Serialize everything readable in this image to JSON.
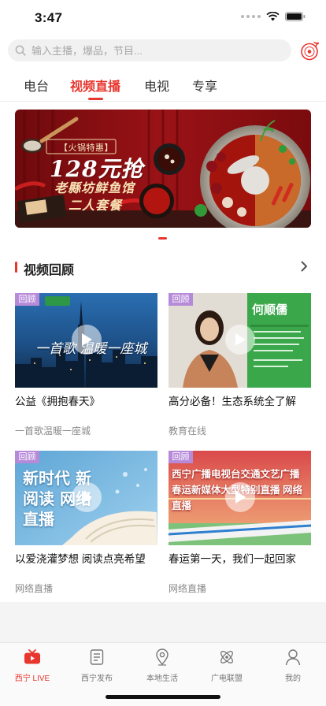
{
  "status_bar": {
    "time": "3:47"
  },
  "search": {
    "placeholder": "输入主播，爆品，节目..."
  },
  "tabs": [
    {
      "label": "电台",
      "active": false
    },
    {
      "label": "视频直播",
      "active": true
    },
    {
      "label": "电视",
      "active": false
    },
    {
      "label": "专享",
      "active": false
    }
  ],
  "banner": {
    "tag": "【火锅特惠】",
    "price": "128元抢",
    "name": "老縣坊鲜鱼馆",
    "set": "二人套餐"
  },
  "section": {
    "title": "视频回顾"
  },
  "cards": [
    {
      "badge": "回顾",
      "title": "公益《拥抱春天》",
      "subtitle": "一首歌温暖一座城",
      "overlay": "一首歌 温暖一座城"
    },
    {
      "badge": "回顾",
      "title": "高分必备！生态系统全了解",
      "subtitle": "教育在线",
      "overlay": "何顺儒"
    },
    {
      "badge": "回顾",
      "title": "以爱浇灌梦想 阅读点亮希望",
      "subtitle": "网络直播",
      "overlay": "新时代 新阅读 网络直播"
    },
    {
      "badge": "回顾",
      "title": "春运第一天，我们一起回家",
      "subtitle": "网络直播",
      "overlay": "西宁广播电视台交通文艺广播 春运新媒体大型特别直播 网络直播"
    }
  ],
  "tab_bar": {
    "items": [
      {
        "label": "西宁 LIVE",
        "icon": "tv-icon",
        "active": true
      },
      {
        "label": "西宁发布",
        "icon": "document-icon",
        "active": false
      },
      {
        "label": "本地生活",
        "icon": "location-icon",
        "active": false
      },
      {
        "label": "广电联盟",
        "icon": "atom-icon",
        "active": false
      },
      {
        "label": "我的",
        "icon": "person-icon",
        "active": false
      }
    ]
  },
  "colors": {
    "accent": "#e8362f",
    "badge": "#b68ad9"
  }
}
